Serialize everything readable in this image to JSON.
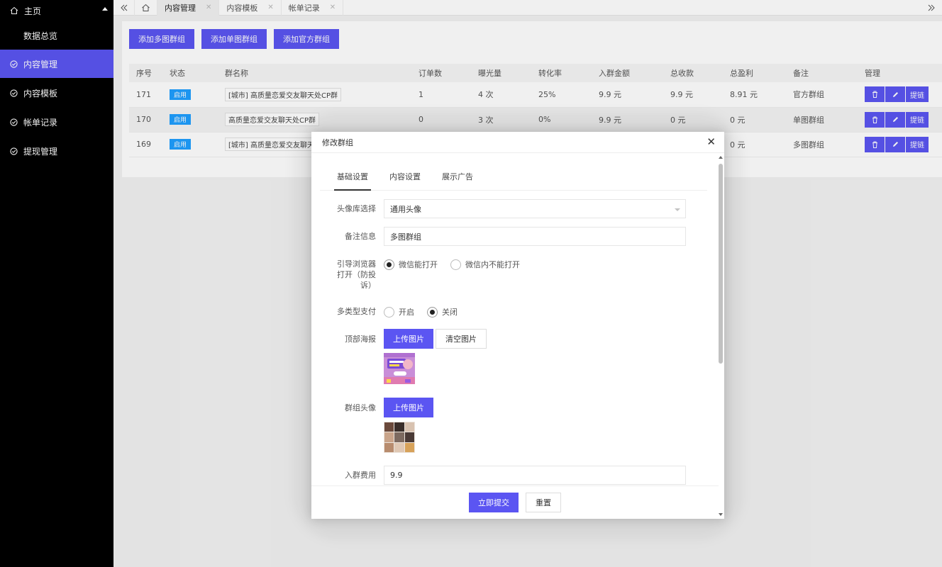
{
  "sidebar": {
    "home": "主页",
    "sub_item": "数据总览",
    "items": [
      {
        "label": "内容管理",
        "active": true
      },
      {
        "label": "内容模板",
        "active": false
      },
      {
        "label": "帐单记录",
        "active": false
      },
      {
        "label": "提现管理",
        "active": false
      }
    ]
  },
  "tabs": [
    {
      "label": "内容管理",
      "active": true
    },
    {
      "label": "内容模板",
      "active": false
    },
    {
      "label": "帐单记录",
      "active": false
    }
  ],
  "actions": [
    "添加多图群组",
    "添加单图群组",
    "添加官方群组"
  ],
  "table": {
    "headers": [
      "序号",
      "状态",
      "群名称",
      "订单数",
      "曝光量",
      "转化率",
      "入群金额",
      "总收款",
      "总盈利",
      "备注",
      "管理"
    ],
    "rows": [
      {
        "id": "171",
        "status": "启用",
        "name": "[城市] 高质量恋爱交友聊天处CP群",
        "orders": "1",
        "exposure": "4 次",
        "rate": "25%",
        "fee": "9.9 元",
        "income": "9.9 元",
        "profit": "8.91 元",
        "note": "官方群组"
      },
      {
        "id": "170",
        "status": "启用",
        "name": "高质量恋爱交友聊天处CP群",
        "orders": "0",
        "exposure": "3 次",
        "rate": "0%",
        "fee": "9.9 元",
        "income": "0 元",
        "profit": "0 元",
        "note": "单图群组"
      },
      {
        "id": "169",
        "status": "启用",
        "name": "[城市] 高质量恋爱交友聊天处",
        "orders": "",
        "exposure": "",
        "rate": "",
        "fee": "",
        "income": "",
        "profit": "0 元",
        "note": "多图群组"
      }
    ],
    "row_btn_link": "提链"
  },
  "modal": {
    "title": "修改群组",
    "tabs": [
      "基础设置",
      "内容设置",
      "展示广告"
    ],
    "fields": {
      "avatar_lib_label": "头像库选择",
      "avatar_lib_value": "通用头像",
      "note_label": "备注信息",
      "note_value": "多图群组",
      "browser_label_1": "引导浏览器",
      "browser_label_2": "打开（防投",
      "browser_label_3": "诉）",
      "browser_opt_1": "微信能打开",
      "browser_opt_2": "微信内不能打开",
      "pay_label": "多类型支付",
      "pay_opt_1": "开启",
      "pay_opt_2": "关闭",
      "poster_label": "顶部海报",
      "upload_btn": "上传图片",
      "clear_btn": "清空图片",
      "group_avatar_label": "群组头像",
      "fee_label": "入群费用",
      "fee_value": "9.9"
    },
    "submit": "立即提交",
    "reset": "重置"
  }
}
